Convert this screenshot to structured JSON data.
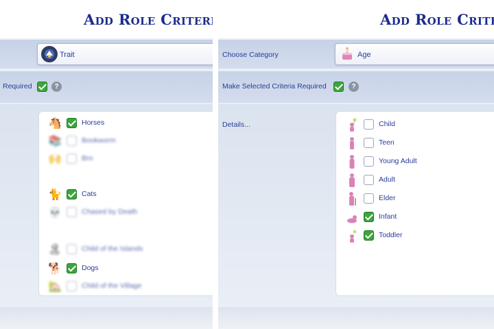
{
  "left_panel": {
    "title": "Add Role Criteria...",
    "category_value": "Trait",
    "required_label": "Required",
    "items": [
      {
        "label": "Horses",
        "checked": true,
        "icon": "horse-icon",
        "glyph": "🐴"
      },
      {
        "label": "Bookworm",
        "checked": false,
        "icon": "books-icon",
        "glyph": "📚"
      },
      {
        "label": "Bro",
        "checked": false,
        "icon": "bro-icon",
        "glyph": "🙌"
      },
      {
        "label": "Cats",
        "checked": true,
        "icon": "cat-icon",
        "glyph": "🐈"
      },
      {
        "label": "Chased by Death",
        "checked": false,
        "icon": "reaper-icon",
        "glyph": "💀"
      },
      {
        "label": "Child of the Islands",
        "checked": false,
        "icon": "island-icon",
        "glyph": "🏝"
      },
      {
        "label": "Dogs",
        "checked": true,
        "icon": "dog-icon",
        "glyph": "🐕"
      },
      {
        "label": "Child of the Village",
        "checked": false,
        "icon": "village-icon",
        "glyph": "🏡"
      }
    ]
  },
  "right_panel": {
    "title": "Add Role Criteria",
    "choose_category_label": "Choose Category",
    "category_value": "Age",
    "required_label": "Make Selected Criteria Required",
    "details_label": "Details...",
    "items": [
      {
        "label": "Child",
        "checked": false,
        "icon": "child-icon"
      },
      {
        "label": "Teen",
        "checked": false,
        "icon": "teen-icon"
      },
      {
        "label": "Young Adult",
        "checked": false,
        "icon": "young-adult-icon"
      },
      {
        "label": "Adult",
        "checked": false,
        "icon": "adult-icon"
      },
      {
        "label": "Elder",
        "checked": false,
        "icon": "elder-icon"
      },
      {
        "label": "Infant",
        "checked": true,
        "icon": "infant-icon"
      },
      {
        "label": "Toddler",
        "checked": true,
        "icon": "toddler-icon"
      }
    ]
  },
  "help_glyph": "?",
  "colors": {
    "title": "#1c2c8c",
    "label": "#283c96",
    "check_on": "#3da53d",
    "sim_figure": "#d983b8"
  }
}
